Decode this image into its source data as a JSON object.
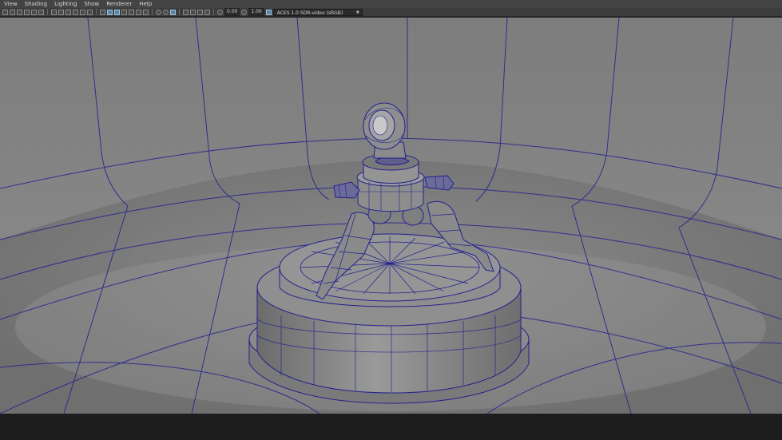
{
  "menu": [
    "View",
    "Shading",
    "Lighting",
    "Show",
    "Renderer",
    "Help"
  ],
  "toolbar": {
    "exposure": "0.00",
    "gamma": "1.00",
    "color_space": "ACES 1.0 SDR-video (sRGB)"
  },
  "icons": [
    "camera-select-icon",
    "camera-attributes-icon",
    "bookmark-icon",
    "grid-icon",
    "wireframe-icon",
    "smooth-shade-icon",
    "textured-icon",
    "lighting-icon",
    "shadows-icon",
    "xray-icon",
    "isolate-icon",
    "resolution-gate-icon",
    "exposure-icon",
    "gamma-icon",
    "color-management-icon"
  ],
  "colors": {
    "wire": "#23208f",
    "surface": "#8b8b8b",
    "background": "#7c7c7c",
    "ui_bar": "#444444"
  }
}
